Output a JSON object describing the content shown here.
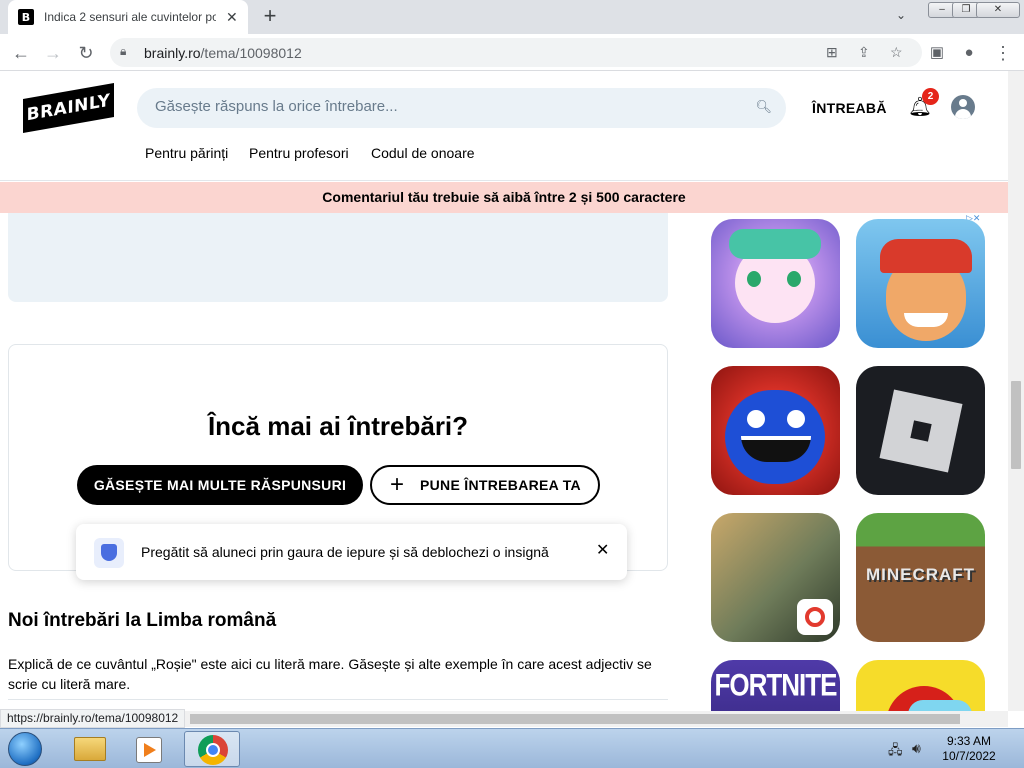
{
  "browser": {
    "tab_title": "Indica 2 sensuri ale cuvintelor po",
    "tab_favicon": "B",
    "url_host": "brainly.ro",
    "url_path": "/tema/10098012",
    "status_url": "https://brainly.ro/tema/10098012"
  },
  "site": {
    "logo": "BRAINLY",
    "search_placeholder": "Găsește răspuns la orice întrebare...",
    "ask_label": "ÎNTREABĂ",
    "notification_count": "2",
    "nav": [
      "Pentru părinți",
      "Pentru profesori",
      "Codul de onoare"
    ]
  },
  "notice": "Comentariul tău trebuie să aibă între 2 și 500 caractere",
  "more": {
    "title": "Încă mai ai întrebări?",
    "find_more_button": "GĂSEȘTE MAI MULTE RĂSPUNSURI",
    "ask_button": "PUNE ÎNTREBAREA TA"
  },
  "toast": {
    "text": "Pregătit să aluneci prin gaura de iepure și să deblochezi o insignă"
  },
  "new_questions": {
    "title": "Noi întrebări la Limba română",
    "first_question": "Explică de ce cuvântul „Roșie\" este aici cu literă mare. Găsește și alte exemple în care acest adjectiv se scrie cu literă mare."
  },
  "ads": {
    "apps": [
      {
        "name": "anime-girl-app-icon",
        "label": ""
      },
      {
        "name": "subway-surfers-app-icon",
        "label": ""
      },
      {
        "name": "poppy-playtime-app-icon",
        "label": ""
      },
      {
        "name": "roblox-app-icon",
        "label": ""
      },
      {
        "name": "free-fire-app-icon",
        "label": ""
      },
      {
        "name": "minecraft-app-icon",
        "label": "MINECRAFT"
      },
      {
        "name": "fortnite-app-icon",
        "label": "FORTNITE"
      },
      {
        "name": "among-us-app-icon",
        "label": ""
      }
    ]
  },
  "taskbar": {
    "time": "9:33 AM",
    "date": "10/7/2022"
  },
  "colors": {
    "notice_bg": "#fbd5d0",
    "search_bg": "#ebf2f7",
    "badge": "#e5251a"
  }
}
